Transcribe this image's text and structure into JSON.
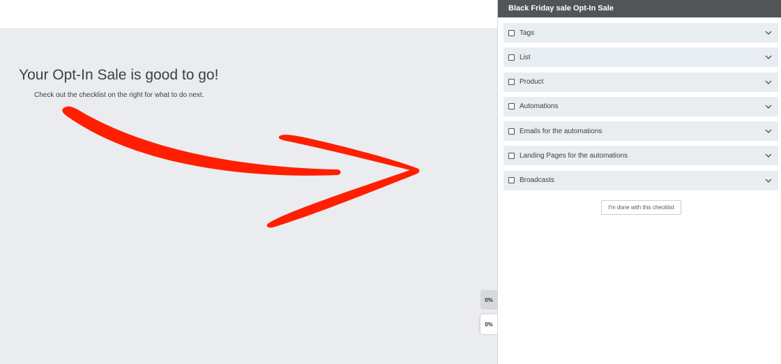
{
  "main": {
    "headline": "Your Opt-In Sale is good to go!",
    "subline": "Check out the checklist on the right for what to do next."
  },
  "progress_tabs": [
    {
      "label": "0%"
    },
    {
      "label": "0%"
    }
  ],
  "panel": {
    "title": "Black Friday sale Opt-In Sale",
    "items": [
      {
        "label": "Tags",
        "checked": false,
        "icon": "chevron-down-icon"
      },
      {
        "label": "List",
        "checked": false,
        "icon": "chevron-down-icon"
      },
      {
        "label": "Product",
        "checked": false,
        "icon": "chevron-down-icon"
      },
      {
        "label": "Automations",
        "checked": false,
        "icon": "chevron-down-icon"
      },
      {
        "label": "Emails for the automations",
        "checked": false,
        "icon": "chevron-down-icon"
      },
      {
        "label": "Landing Pages for the automations",
        "checked": false,
        "icon": "chevron-down-icon"
      },
      {
        "label": "Broadcasts",
        "checked": false,
        "icon": "chevron-down-icon"
      }
    ],
    "done_button_label": "I'm done with this checklist"
  },
  "colors": {
    "panel_header_bg": "#525558",
    "item_bg": "#e8edf1",
    "page_bg": "#ebecef",
    "arrow": "#ff1f00"
  }
}
